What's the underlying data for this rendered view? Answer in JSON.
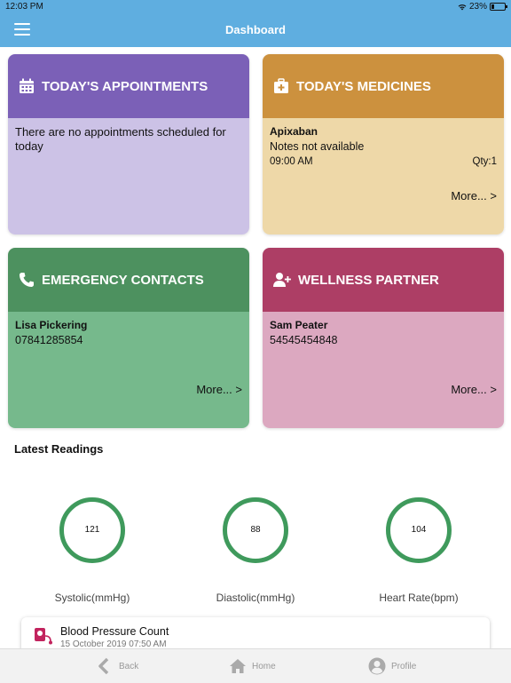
{
  "status_bar": {
    "time": "12:03 PM",
    "battery": "23%"
  },
  "header": {
    "title": "Dashboard"
  },
  "cards": {
    "appointments": {
      "title": "TODAY'S APPOINTMENTS",
      "message": "There are no appointments scheduled for today",
      "color": "#7b60b7"
    },
    "medicines": {
      "title": "TODAY'S MEDICINES",
      "name": "Apixaban",
      "notes": "Notes not available",
      "time": "09:00 AM",
      "qty": "Qty:1",
      "more": "More...  >",
      "color": "#cc913e"
    },
    "emergency": {
      "title": "EMERGENCY CONTACTS",
      "name": "Lisa Pickering",
      "phone": "07841285854",
      "more": "More...  >",
      "color": "#4d915f"
    },
    "wellness": {
      "title": "WELLNESS PARTNER",
      "name": "Sam Peater",
      "phone": "54545454848",
      "more": "More...  >",
      "color": "#ad3e65"
    }
  },
  "readings": {
    "title": "Latest Readings",
    "items": [
      {
        "value": "121",
        "label": "Systolic(mmHg)"
      },
      {
        "value": "88",
        "label": "Diastolic(mmHg)"
      },
      {
        "value": "104",
        "label": "Heart Rate(bpm)"
      }
    ],
    "ring_color": "#3f9a5c"
  },
  "bp_card": {
    "title": "Blood Pressure Count",
    "date": "15 October 2019 07:50 AM"
  },
  "tab_bar": {
    "back": "Back",
    "home": "Home",
    "profile": "Profile"
  }
}
